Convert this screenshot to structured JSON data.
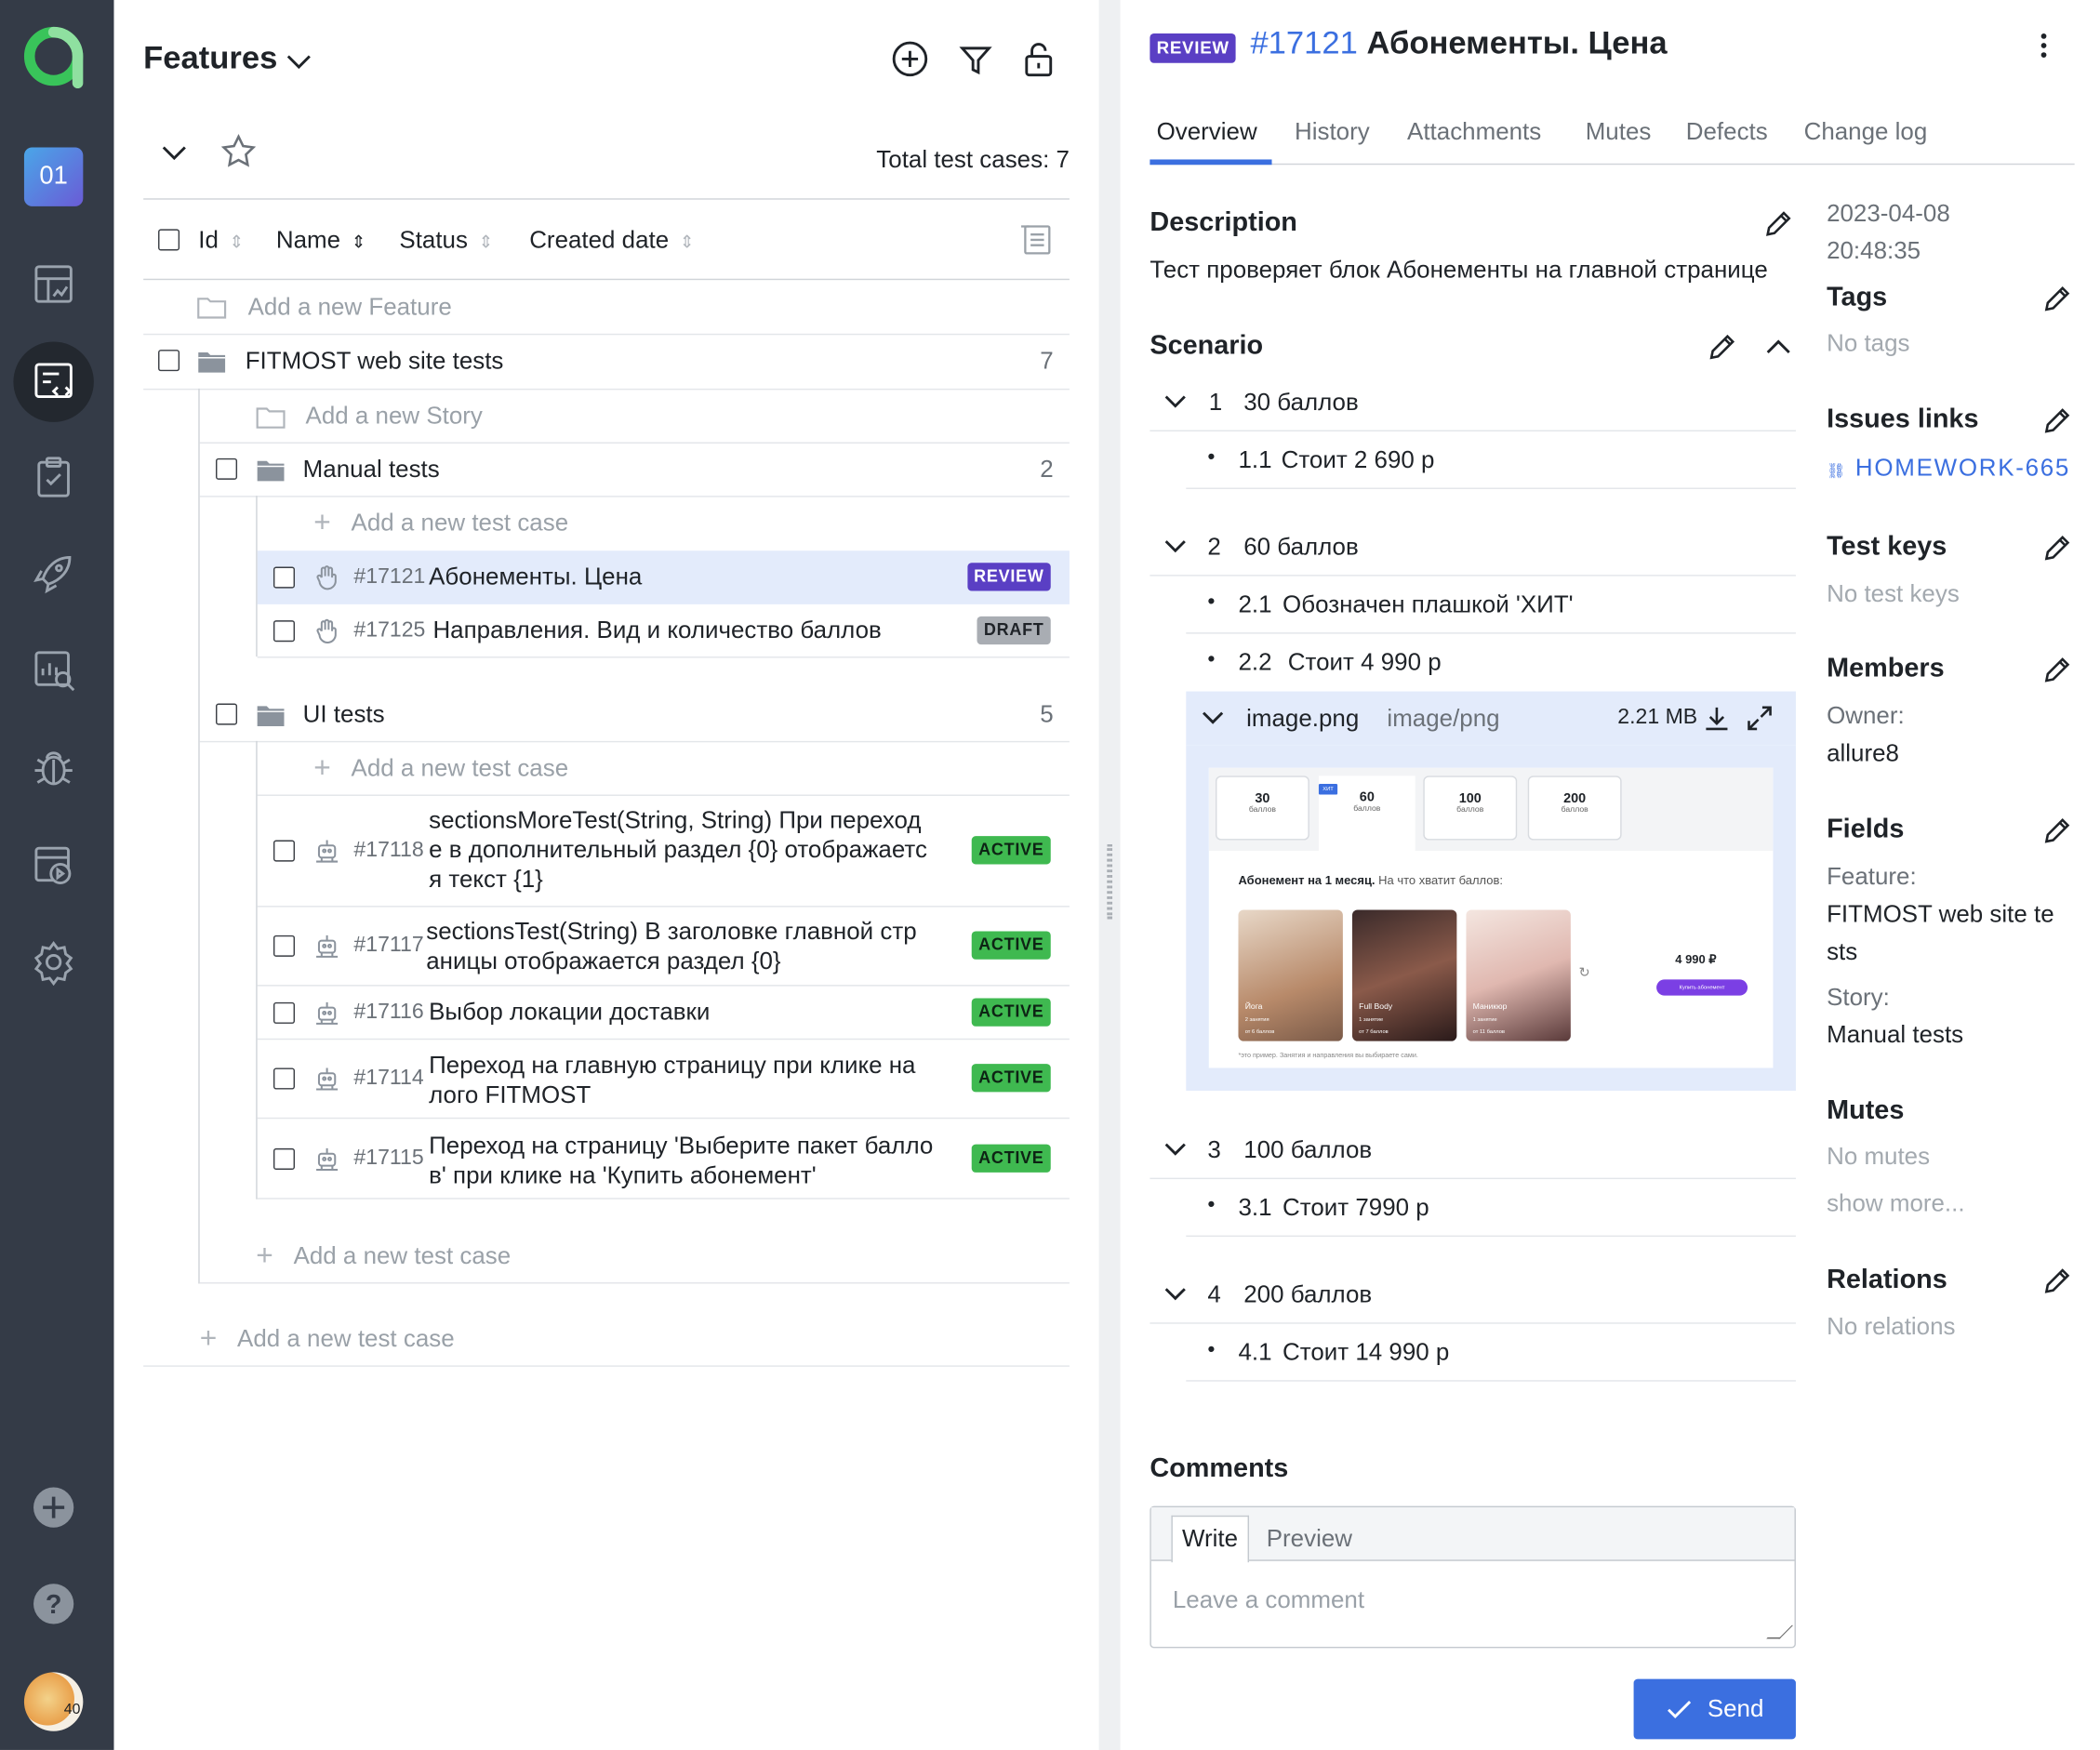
{
  "sidebar": {
    "project_badge": "01",
    "avatar_text": "40",
    "items": [
      "dashboard-icon",
      "test-cases-icon",
      "test-plans-icon",
      "launches-icon",
      "analytics-icon",
      "defects-icon",
      "jobs-icon",
      "settings-icon"
    ]
  },
  "tree": {
    "title": "Features",
    "total": "Total test cases: 7",
    "columns": {
      "id": "Id",
      "name": "Name",
      "status": "Status",
      "created": "Created date"
    },
    "add_feature": "Add a new Feature",
    "add_story": "Add a new Story",
    "add_case": "Add a new test case",
    "feature": {
      "name": "FITMOST web site tests",
      "count": "7"
    },
    "manual": {
      "name": "Manual tests",
      "count": "2",
      "cases": [
        {
          "id": "#17121",
          "name": "Абонементы. Цена",
          "status": "REVIEW"
        },
        {
          "id": "#17125",
          "name": "Направления. Вид и количество баллов",
          "status": "DRAFT"
        }
      ]
    },
    "ui": {
      "name": "UI tests",
      "count": "5",
      "cases": [
        {
          "id": "#17118",
          "line1": "sectionsMoreTest(String, String) При переход",
          "line2": "е в дополнительный раздел {0} отображаетс",
          "line3": "я текст {1}",
          "status": "ACTIVE"
        },
        {
          "id": "#17117",
          "line1": "sectionsTest(String) В заголовке главной стр",
          "line2": "аницы отображается раздел {0}",
          "status": "ACTIVE"
        },
        {
          "id": "#17116",
          "line1": "Выбор локации доставки",
          "status": "ACTIVE"
        },
        {
          "id": "#17114",
          "line1": "Переход на главную страницу при клике на",
          "line2": "лого FITMOST",
          "status": "ACTIVE"
        },
        {
          "id": "#17115",
          "line1": "Переход на страницу 'Выберите пакет балло",
          "line2": "в' при клике на 'Купить абонемент'",
          "status": "ACTIVE"
        }
      ]
    }
  },
  "detail": {
    "status": "REVIEW",
    "id": "#17121",
    "title": "Абонементы. Цена",
    "tabs": [
      "Overview",
      "History",
      "Attachments",
      "Mutes",
      "Defects",
      "Change log"
    ],
    "description_title": "Description",
    "description": "Тест проверяет блок Абонементы на главной странице",
    "scenario_title": "Scenario",
    "steps": [
      {
        "n": "1",
        "text": "30 баллов",
        "sub": [
          {
            "n": "1.1",
            "text": "Стоит 2 690 р"
          }
        ]
      },
      {
        "n": "2",
        "text": "60 баллов",
        "sub": [
          {
            "n": "2.1",
            "text": "Обозначен плашкой 'ХИТ'"
          },
          {
            "n": "2.2",
            "text": "Стоит 4 990 р"
          }
        ]
      },
      {
        "n": "3",
        "text": "100 баллов",
        "sub": [
          {
            "n": "3.1",
            "text": "Стоит 7990 р"
          }
        ]
      },
      {
        "n": "4",
        "text": "200 баллов",
        "sub": [
          {
            "n": "4.1",
            "text": "Стоит 14 990 р"
          }
        ]
      }
    ],
    "attachment": {
      "name": "image.png",
      "type": "image/png",
      "size": "2.21 MB"
    },
    "preview": {
      "packages": [
        {
          "v": "30",
          "u": "баллов"
        },
        {
          "v": "60",
          "u": "баллов"
        },
        {
          "v": "100",
          "u": "баллов"
        },
        {
          "v": "200",
          "u": "баллов"
        }
      ],
      "hit": "ХИТ",
      "heading": "Абонемент на 1 месяц.",
      "heading_sub": "На что хватит баллов:",
      "cards": [
        {
          "t": "Йога",
          "s1": "2 занятия",
          "s2": "от 6 баллов"
        },
        {
          "t": "Full Body",
          "s1": "1 занятие",
          "s2": "от 7 баллов"
        },
        {
          "t": "Маникюр",
          "s1": "1 занятие",
          "s2": "от 11 баллов"
        }
      ],
      "price": "4 990 ₽",
      "buy": "Купить абонемент",
      "note": "*это пример. Занятия и направления вы выбираете сами."
    },
    "comments_title": "Comments",
    "comment_tabs": [
      "Write",
      "Preview"
    ],
    "comment_placeholder": "Leave a comment",
    "send": "Send"
  },
  "side": {
    "created": "2023-04-08",
    "created_time": "20:48:35",
    "tags_title": "Tags",
    "tags": "No tags",
    "issues_title": "Issues links",
    "issue": "HOMEWORK-665",
    "keys_title": "Test keys",
    "keys": "No test keys",
    "members_title": "Members",
    "owner_label": "Owner:",
    "owner": "allure8",
    "fields_title": "Fields",
    "feature_label": "Feature:",
    "feature_l1": "FITMOST web site te",
    "feature_l2": "sts",
    "story_label": "Story:",
    "story": "Manual tests",
    "mutes_title": "Mutes",
    "mutes": "No mutes",
    "show_more": "show more...",
    "relations_title": "Relations",
    "relations": "No relations"
  },
  "colors": {
    "sidebar": "#343b47",
    "accent": "#3b6fe0",
    "active": "#3fb950",
    "review": "#5a3fc4",
    "selected": "#e3ebfb"
  }
}
